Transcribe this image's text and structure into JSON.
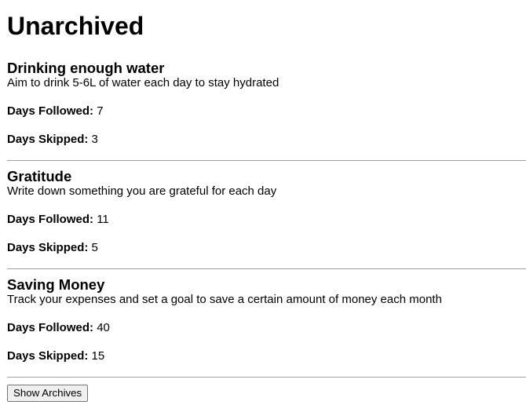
{
  "page": {
    "title": "Unarchived"
  },
  "habits": [
    {
      "title": "Drinking enough water",
      "description": "Aim to drink 5-6L of water each day to stay hydrated",
      "followed_label": "Days Followed:",
      "followed_value": "7",
      "skipped_label": "Days Skipped:",
      "skipped_value": "3"
    },
    {
      "title": "Gratitude",
      "description": "Write down something you are grateful for each day",
      "followed_label": "Days Followed:",
      "followed_value": "11",
      "skipped_label": "Days Skipped:",
      "skipped_value": "5"
    },
    {
      "title": "Saving Money",
      "description": "Track your expenses and set a goal to save a certain amount of money each month",
      "followed_label": "Days Followed:",
      "followed_value": "40",
      "skipped_label": "Days Skipped:",
      "skipped_value": "15"
    }
  ],
  "actions": {
    "show_archives_label": "Show Archives"
  }
}
